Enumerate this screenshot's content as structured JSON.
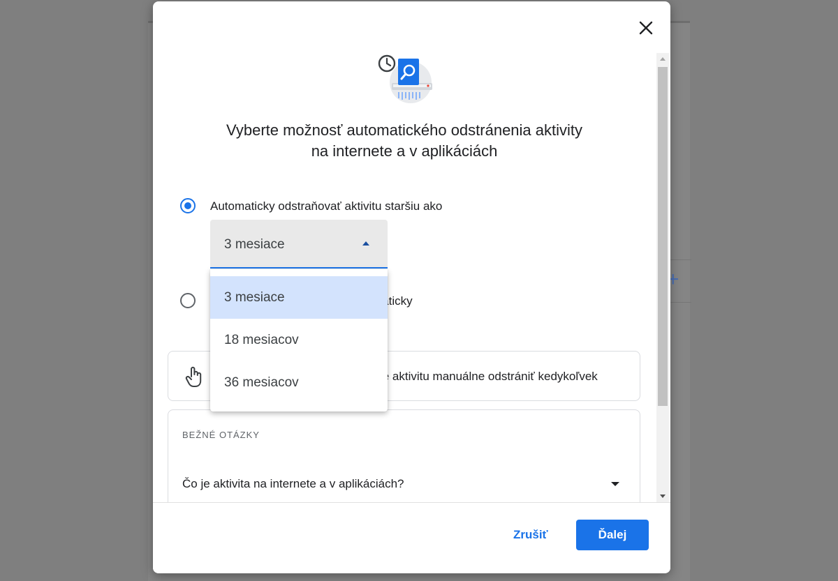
{
  "dialog": {
    "heading_line1": "Vyberte možnosť automatického odstránenia aktivity",
    "heading_line2": "na internete a v aplikáciách",
    "option_auto": {
      "label": "Automaticky odstraňovať aktivitu staršiu ako",
      "checked": true,
      "selected_value": "3 mesiace"
    },
    "option_manual": {
      "label_visible_part": "maticky",
      "checked": false
    },
    "dropdown_options": [
      "3 mesiace",
      "18 mesiacov",
      "36 mesiacov"
    ],
    "info_text_visible_part": "te aktivitu manuálne odstrániť kedykoľvek",
    "faq": {
      "title": "BEŽNÉ OTÁZKY",
      "question": "Čo je aktivita na internete a v aplikáciách?"
    },
    "footer": {
      "cancel_label": "Zrušiť",
      "next_label": "Ďalej"
    }
  },
  "colors": {
    "accent": "#1a73e8",
    "selected_option_bg": "#d3e3fd",
    "overlay": "#7f7f7f"
  },
  "icons": [
    "close-icon",
    "auto-delete-illustration-icon",
    "hand-pointer-icon",
    "chevron-down-icon",
    "chevron-up-icon"
  ]
}
